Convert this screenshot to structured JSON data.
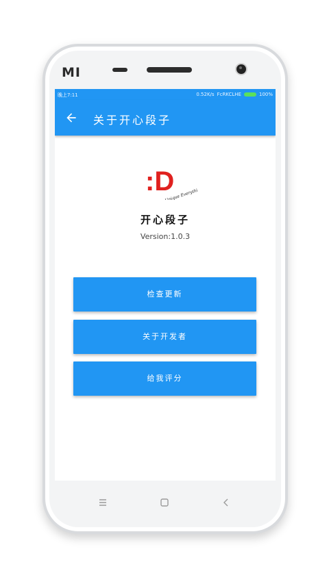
{
  "device": {
    "brand": "MI"
  },
  "status_bar": {
    "time": "晚上7:11",
    "network_info": "0.52K/s",
    "carrier": "FcRKCLHE",
    "battery": "100%"
  },
  "app_bar": {
    "title": "关于开心段子",
    "back_icon": "arrow-left-icon"
  },
  "about": {
    "logo_text": ":D",
    "logo_signature": "Unique Everything",
    "app_name": "开心段子",
    "version": "Version:1.0.3"
  },
  "buttons": {
    "check_update": "检查更新",
    "about_developer": "关于开发者",
    "rate": "给我评分"
  },
  "nav_bar": {
    "menu_icon": "menu-icon",
    "home_icon": "home-icon",
    "back_icon": "back-icon"
  },
  "colors": {
    "primary": "#2196f3",
    "logo_red": "#e0211f",
    "battery": "#5be05b"
  }
}
